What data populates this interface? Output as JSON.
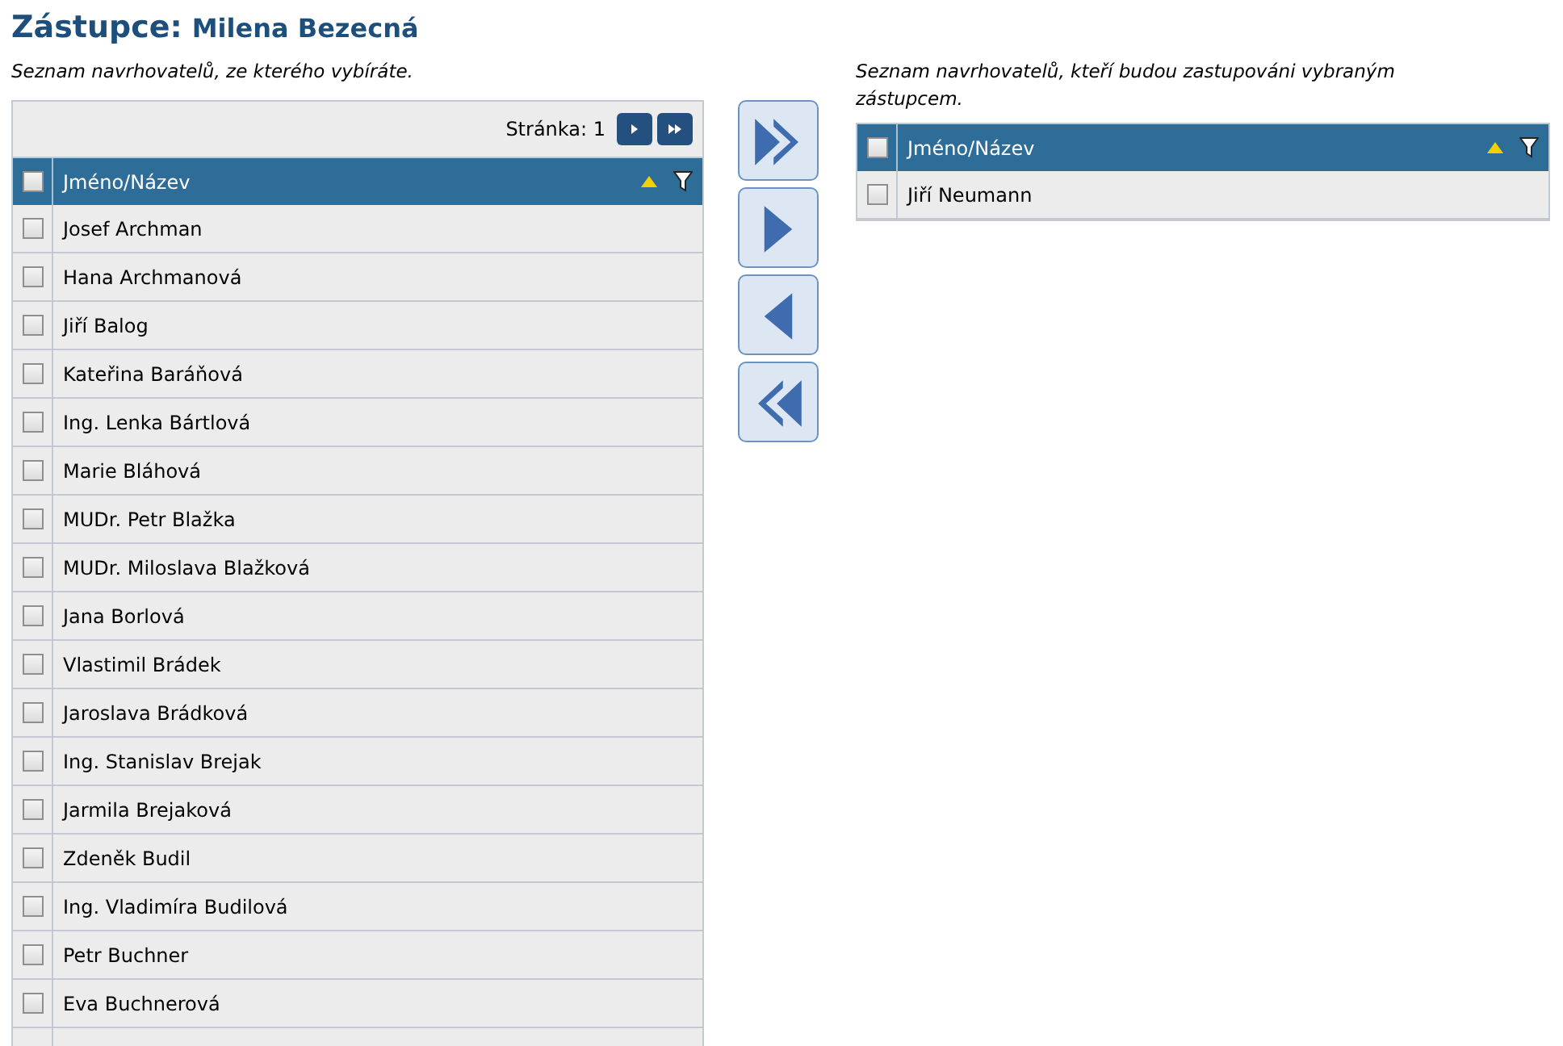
{
  "heading": {
    "label": "Zástupce:",
    "name": "Milena Bezecná"
  },
  "source_list": {
    "caption": "Seznam navrhovatelů, ze kterého vybíráte.",
    "pager": {
      "label": "Stránka: 1"
    },
    "header": {
      "column": "Jméno/Název",
      "checked": false
    },
    "rows": [
      {
        "name": "Josef Archman",
        "checked": false
      },
      {
        "name": "Hana Archmanová",
        "checked": false
      },
      {
        "name": "Jiří Balog",
        "checked": false
      },
      {
        "name": "Kateřina Baráňová",
        "checked": false
      },
      {
        "name": "Ing. Lenka Bártlová",
        "checked": false
      },
      {
        "name": "Marie Bláhová",
        "checked": false
      },
      {
        "name": "MUDr. Petr Blažka",
        "checked": false
      },
      {
        "name": "MUDr. Miloslava Blažková",
        "checked": false
      },
      {
        "name": "Jana Borlová",
        "checked": false
      },
      {
        "name": "Vlastimil Brádek",
        "checked": false
      },
      {
        "name": "Jaroslava Brádková",
        "checked": false
      },
      {
        "name": "Ing. Stanislav Brejak",
        "checked": false
      },
      {
        "name": "Jarmila Brejaková",
        "checked": false
      },
      {
        "name": "Zdeněk Budil",
        "checked": false
      },
      {
        "name": "Ing. Vladimíra Budilová",
        "checked": false
      },
      {
        "name": "Petr Buchner",
        "checked": false
      },
      {
        "name": "Eva Buchnerová",
        "checked": false
      }
    ]
  },
  "move_buttons": [
    {
      "kind": "all-right"
    },
    {
      "kind": "right"
    },
    {
      "kind": "left"
    },
    {
      "kind": "all-left"
    }
  ],
  "target_list": {
    "caption": "Seznam navrhovatelů, kteří budou zastupováni vybraným zástupcem.",
    "header": {
      "column": "Jméno/Název",
      "checked": false
    },
    "rows": [
      {
        "name": "Jiří Neumann",
        "checked": false
      }
    ]
  }
}
